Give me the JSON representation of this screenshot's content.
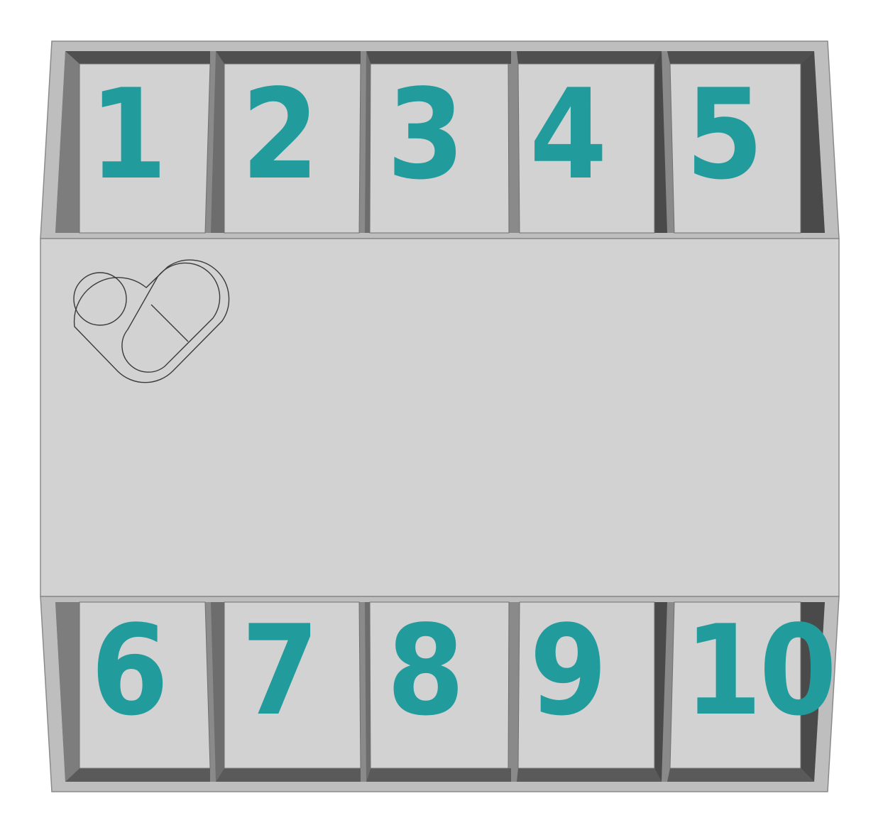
{
  "compartments_top": [
    {
      "label": "1"
    },
    {
      "label": "2"
    },
    {
      "label": "3"
    },
    {
      "label": "4"
    },
    {
      "label": "5"
    }
  ],
  "compartments_bottom": [
    {
      "label": "6"
    },
    {
      "label": "7"
    },
    {
      "label": "8"
    },
    {
      "label": "9"
    },
    {
      "label": "10"
    }
  ],
  "logo": {
    "icon": "pill-heart-icon"
  },
  "colors": {
    "body": "#d2d2d2",
    "wall": "#bdbdbd",
    "shadow": "#4a4a4a",
    "number": "#229b9d",
    "outline": "#8a8a8a"
  }
}
